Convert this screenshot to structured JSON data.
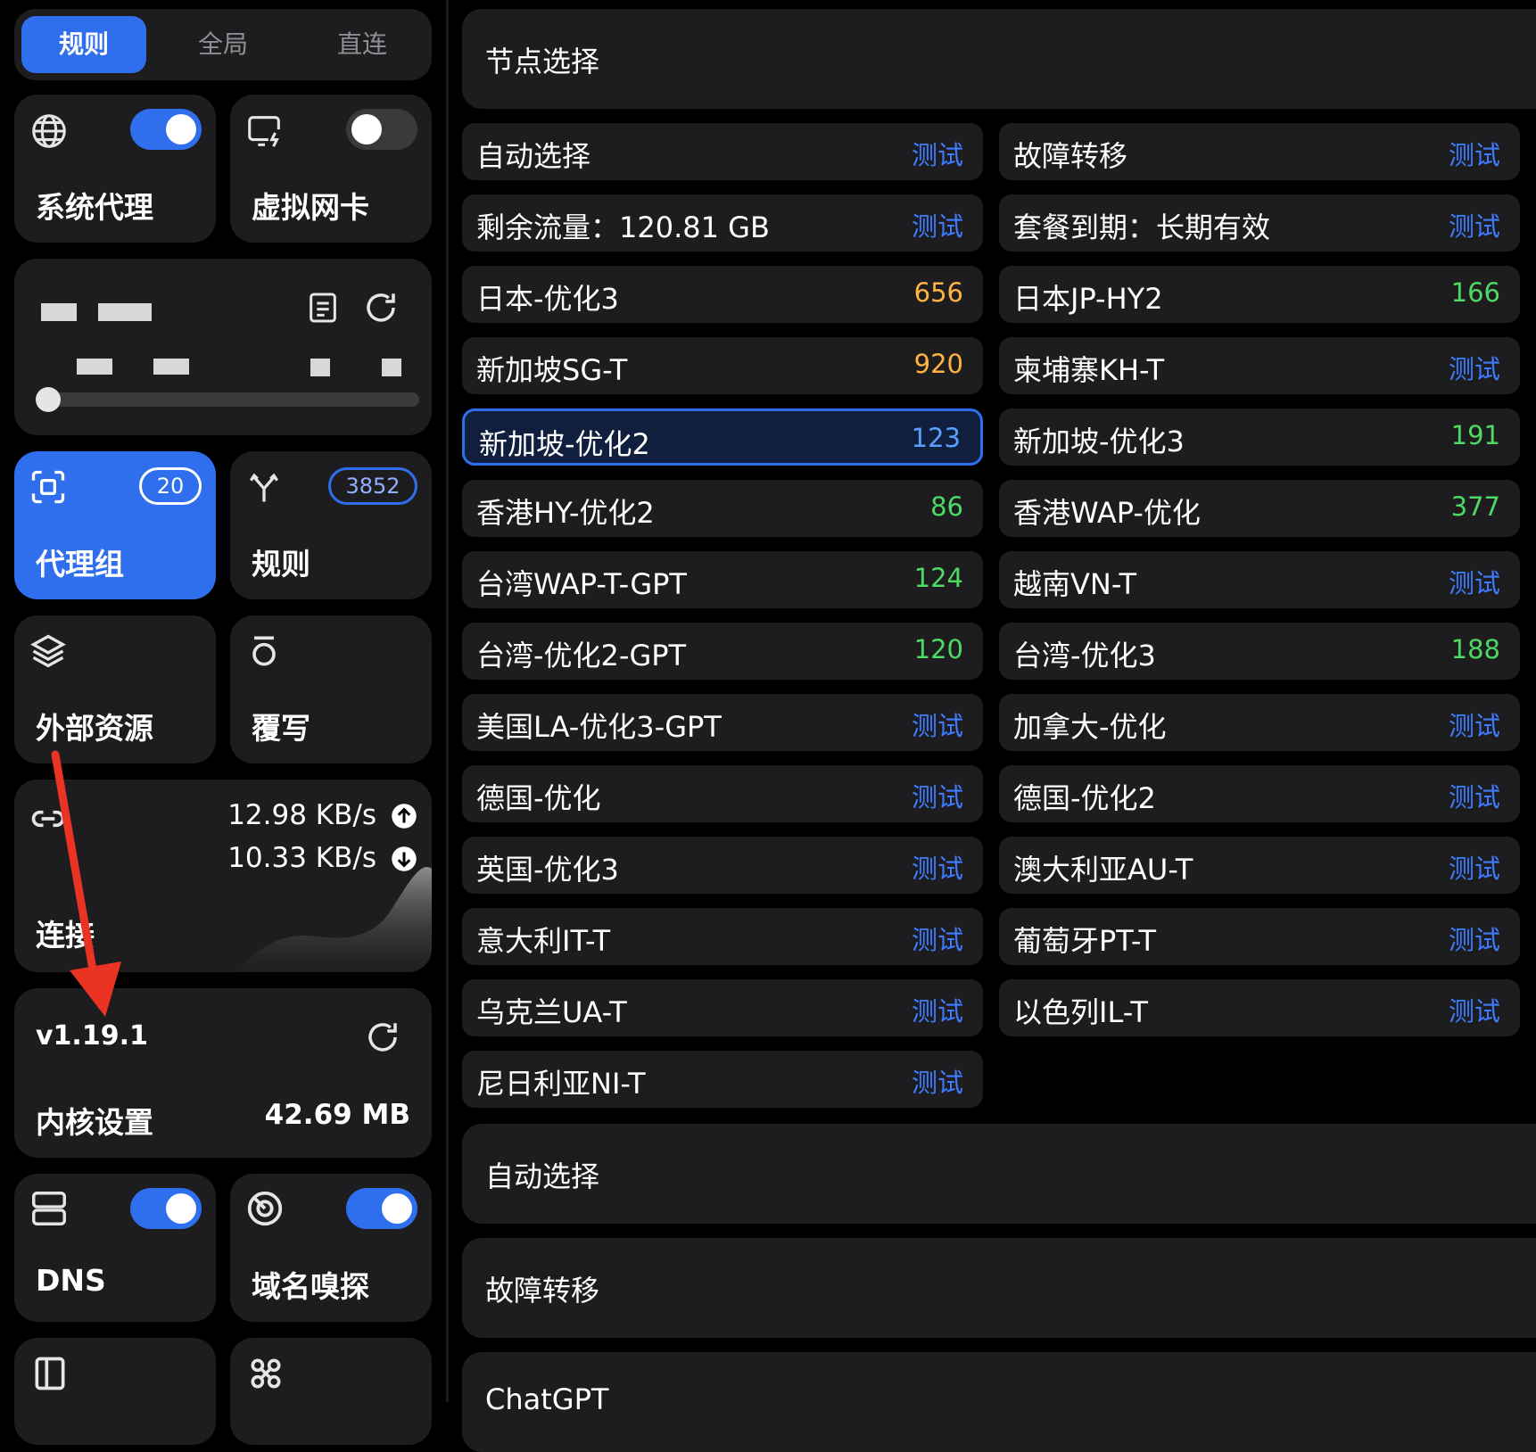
{
  "mode_tabs": [
    {
      "label": "规则",
      "active": true
    },
    {
      "label": "全局",
      "active": false
    },
    {
      "label": "直连",
      "active": false
    }
  ],
  "system_proxy": {
    "label": "系统代理",
    "icon": "globe-icon",
    "enabled": true
  },
  "virtual_nic": {
    "label": "虚拟网卡",
    "icon": "monitor-lightning-icon",
    "enabled": false
  },
  "profile_card": {
    "icons": [
      "document-icon",
      "refresh-icon"
    ]
  },
  "proxy_groups": {
    "label": "代理组",
    "count": "20",
    "icon": "scan-icon"
  },
  "rules": {
    "label": "规则",
    "count": "3852",
    "icon": "branch-icon"
  },
  "external_resources": {
    "label": "外部资源",
    "icon": "layers-icon"
  },
  "override": {
    "label": "覆写",
    "icon": "override-icon"
  },
  "connections": {
    "label": "连接",
    "upload": "12.98 KB/s",
    "download": "10.33 KB/s",
    "icon": "link-icon"
  },
  "core": {
    "version": "v1.19.1",
    "label": "内核设置",
    "memory": "42.69 MB"
  },
  "dns": {
    "label": "DNS",
    "enabled": true,
    "icon": "server-icon"
  },
  "sniff": {
    "label": "域名嗅探",
    "enabled": true,
    "icon": "radar-icon"
  },
  "group_header": {
    "title": "节点选择"
  },
  "nodes": [
    {
      "name": "自动选择",
      "value": "测试",
      "kind": "test"
    },
    {
      "name": "故障转移",
      "value": "测试",
      "kind": "test"
    },
    {
      "name": "剩余流量：120.81 GB",
      "value": "测试",
      "kind": "test"
    },
    {
      "name": "套餐到期：长期有效",
      "value": "测试",
      "kind": "test"
    },
    {
      "name": "日本-优化3",
      "value": "656",
      "kind": "orange"
    },
    {
      "name": "日本JP-HY2",
      "value": "166",
      "kind": "green"
    },
    {
      "name": "新加坡SG-T",
      "value": "920",
      "kind": "orange"
    },
    {
      "name": "柬埔寨KH-T",
      "value": "测试",
      "kind": "test"
    },
    {
      "name": "新加坡-优化2",
      "value": "123",
      "kind": "selected"
    },
    {
      "name": "新加坡-优化3",
      "value": "191",
      "kind": "green"
    },
    {
      "name": "香港HY-优化2",
      "value": "86",
      "kind": "green"
    },
    {
      "name": "香港WAP-优化",
      "value": "377",
      "kind": "green"
    },
    {
      "name": "台湾WAP-T-GPT",
      "value": "124",
      "kind": "green"
    },
    {
      "name": "越南VN-T",
      "value": "测试",
      "kind": "test"
    },
    {
      "name": "台湾-优化2-GPT",
      "value": "120",
      "kind": "green"
    },
    {
      "name": "台湾-优化3",
      "value": "188",
      "kind": "green"
    },
    {
      "name": "美国LA-优化3-GPT",
      "value": "测试",
      "kind": "test"
    },
    {
      "name": "加拿大-优化",
      "value": "测试",
      "kind": "test"
    },
    {
      "name": "德国-优化",
      "value": "测试",
      "kind": "test"
    },
    {
      "name": "德国-优化2",
      "value": "测试",
      "kind": "test"
    },
    {
      "name": "英国-优化3",
      "value": "测试",
      "kind": "test"
    },
    {
      "name": "澳大利亚AU-T",
      "value": "测试",
      "kind": "test"
    },
    {
      "name": "意大利IT-T",
      "value": "测试",
      "kind": "test"
    },
    {
      "name": "葡萄牙PT-T",
      "value": "测试",
      "kind": "test"
    },
    {
      "name": "乌克兰UA-T",
      "value": "测试",
      "kind": "test"
    },
    {
      "name": "以色列IL-T",
      "value": "测试",
      "kind": "test"
    },
    {
      "name": "尼日利亚NI-T",
      "value": "测试",
      "kind": "test"
    }
  ],
  "other_groups": [
    {
      "title": "自动选择"
    },
    {
      "title": "故障转移"
    },
    {
      "title": "ChatGPT"
    }
  ]
}
